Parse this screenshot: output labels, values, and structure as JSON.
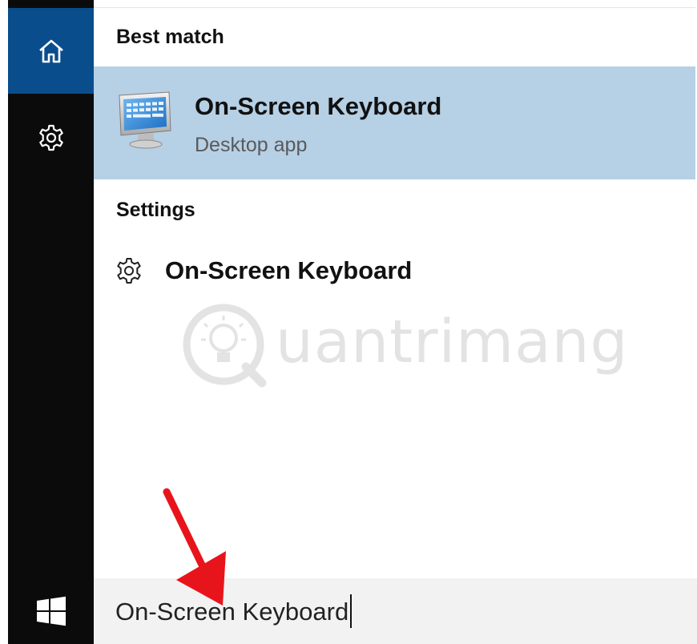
{
  "sidebar": {
    "home_icon": "home-icon",
    "settings_icon": "gear-icon",
    "start_icon": "windows-logo-icon",
    "accent": "#0a4d8c"
  },
  "best_match": {
    "heading": "Best match",
    "app": {
      "title": "On-Screen Keyboard",
      "subtitle": "Desktop app",
      "icon": "monitor-keyboard-icon",
      "highlight": "#b6d0e5"
    }
  },
  "settings": {
    "heading": "Settings",
    "items": [
      {
        "label": "On-Screen Keyboard",
        "icon": "gear-icon"
      }
    ]
  },
  "watermark": {
    "text": "uantrimang"
  },
  "search": {
    "value": "On-Screen Keyboard"
  },
  "annotation": {
    "arrow_color": "#e8141c"
  }
}
